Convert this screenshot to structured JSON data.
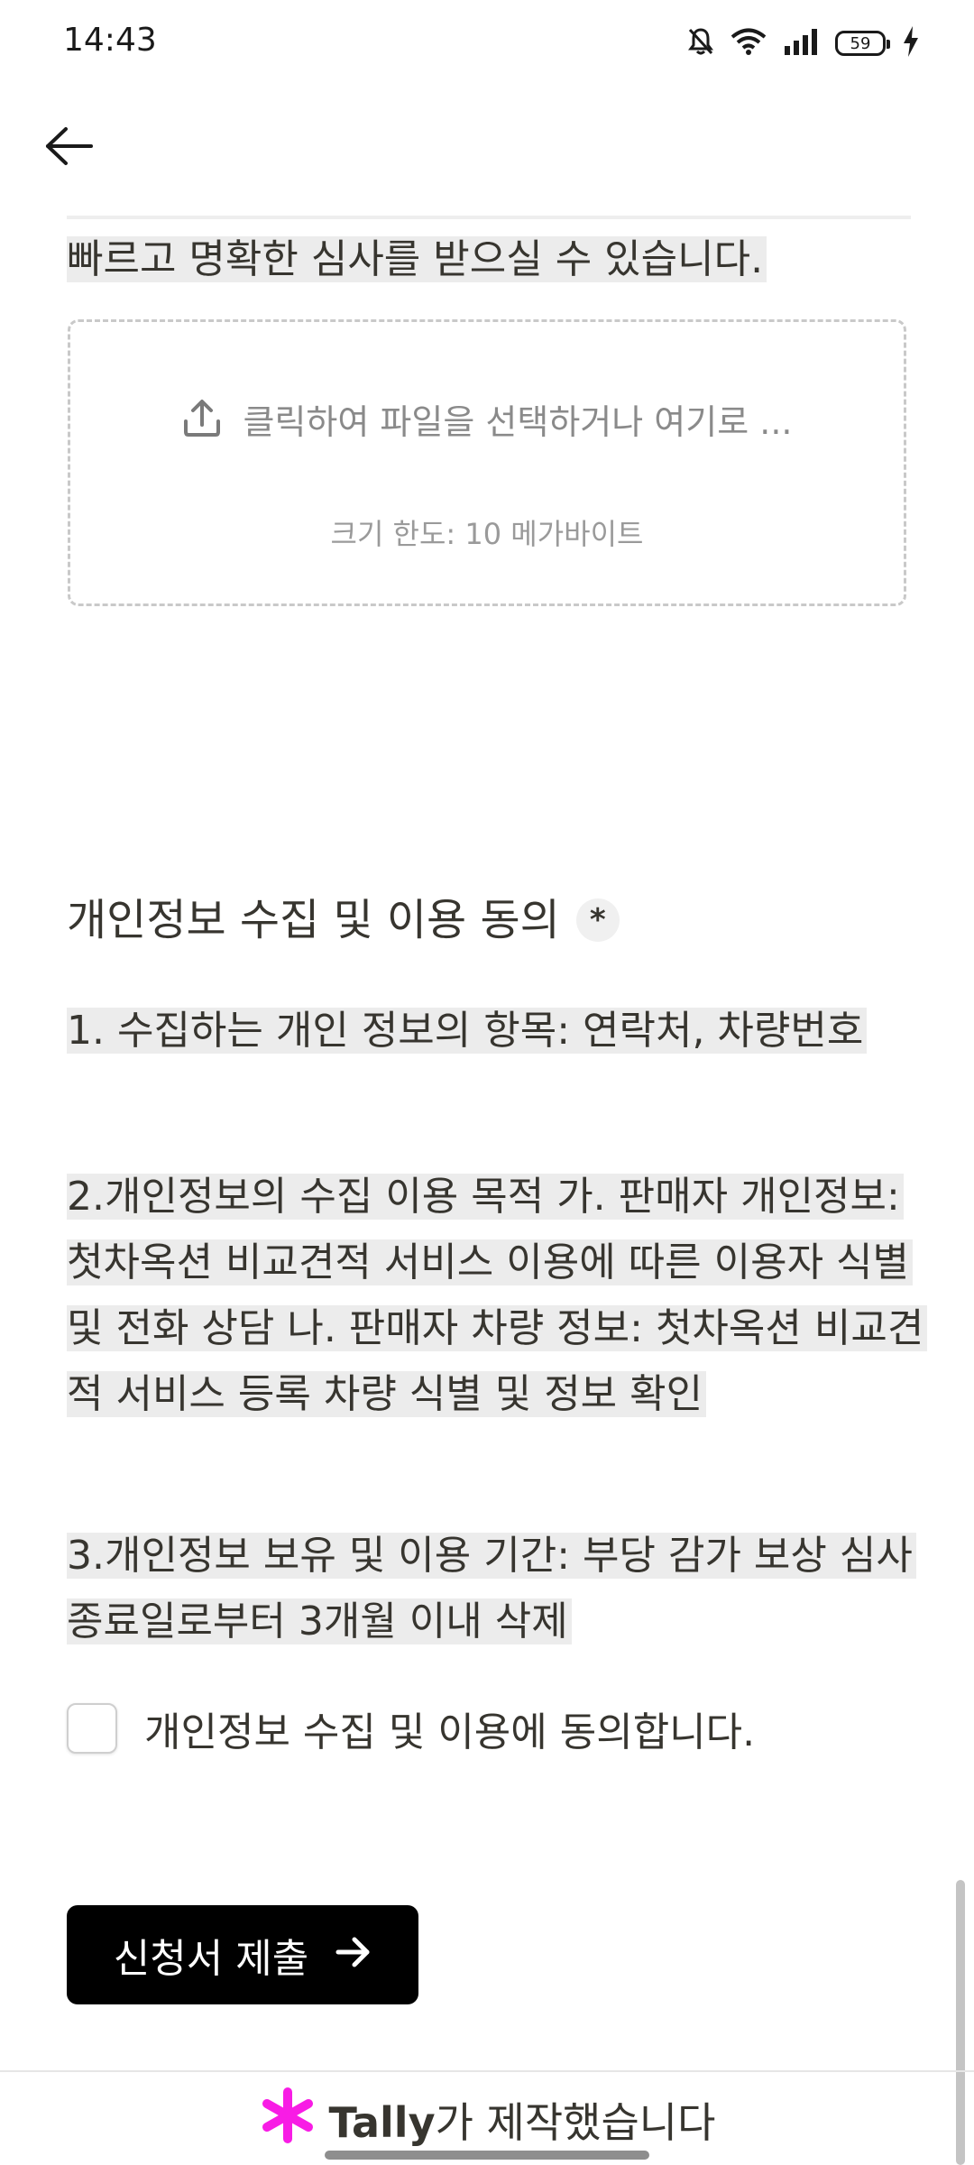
{
  "status_bar": {
    "time": "14:43",
    "battery_level": "59",
    "icons": [
      "bell-off-icon",
      "wifi-icon",
      "signal-icon",
      "battery-icon",
      "charging-bolt-icon"
    ]
  },
  "nav": {
    "back_icon": "arrow-left-icon"
  },
  "form": {
    "intro_text": "빠르고 명확한 심사를 받으실 수 있습니다.",
    "upload": {
      "prompt": "클릭하여 파일을 선택하거나 여기로 ...",
      "limit": "크기 한도: 10 메가바이트",
      "icon": "upload-icon"
    },
    "privacy": {
      "title": "개인정보 수집 및 이용 동의",
      "required_mark": "*",
      "item1": "1. 수집하는 개인 정보의 항목: 연락처, 차량번호",
      "item2": "2.개인정보의 수집 이용 목적 가. 판매자 개인정보: 첫차옥션 비교견적 서비스 이용에 따른 이용자 식별 및 전화 상담 나. 판매자 차량 정보: 첫차옥션 비교견적 서비스 등록 차량 식별 및 정보 확인",
      "item3": "3.개인정보 보유 및 이용 기간: 부당 감가 보상 심사 종료일로부터 3개월 이내 삭제",
      "consent_label": "개인정보 수집 및 이용에 동의합니다.",
      "consent_checked": false
    },
    "submit_label": "신청서 제출",
    "submit_icon": "arrow-right-icon"
  },
  "footer": {
    "brand": "Tally",
    "suffix": "가 제작했습니다",
    "logo_color": "#f81ce5"
  },
  "colors": {
    "text": "#37352f",
    "highlight": "#ececec",
    "button_bg": "#000000",
    "button_text": "#ffffff"
  }
}
